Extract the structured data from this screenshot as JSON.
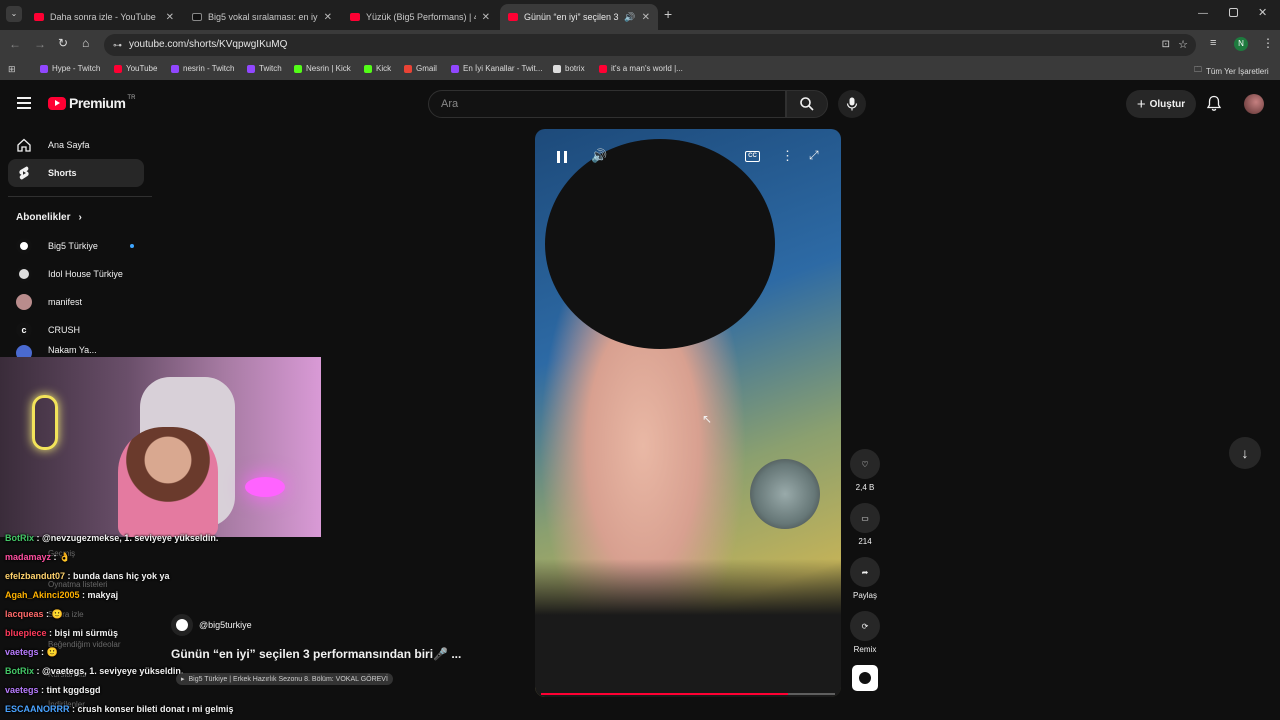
{
  "browser": {
    "tabs": [
      {
        "title": "Daha sonra izle - YouTube",
        "icon": "youtube-icon"
      },
      {
        "title": "Big5 vokal sıralaması: en iyi 22 -",
        "icon": "tiktok-icon"
      },
      {
        "title": "Yüzük (Big5 Performans) | 4. Gr",
        "icon": "youtube-icon"
      },
      {
        "title": "Günün “en iyi” seçilen 3 per",
        "icon": "youtube-icon"
      }
    ],
    "new_tab": "+",
    "url": "youtube.com/shorts/KVqpwgIKuMQ",
    "profile_initial": "N",
    "bookmarks": [
      {
        "label": "Hype - Twitch",
        "color": "#9147ff"
      },
      {
        "label": "YouTube",
        "color": "#ff0033"
      },
      {
        "label": "nesrin - Twitch",
        "color": "#9147ff"
      },
      {
        "label": "Twitch",
        "color": "#9147ff"
      },
      {
        "label": "Nesrin | Kick",
        "color": "#53fc18"
      },
      {
        "label": "Kick",
        "color": "#53fc18"
      },
      {
        "label": "Gmail",
        "color": "#ea4335"
      },
      {
        "label": "En İyi Kanallar - Twit...",
        "color": "#9147ff"
      },
      {
        "label": "botrix",
        "color": "#dddddd"
      },
      {
        "label": "it's a man's world |...",
        "color": "#ff0033"
      }
    ],
    "all_bookmarks": "Tüm Yer İşaretleri"
  },
  "youtube": {
    "logo_text": "Premium",
    "logo_region": "TR",
    "search_placeholder": "Ara",
    "create_label": "Oluştur",
    "sidebar": {
      "items": [
        {
          "label": "Ana Sayfa",
          "icon": "home-icon"
        },
        {
          "label": "Shorts",
          "icon": "shorts-icon"
        }
      ],
      "subs_title": "Abonelikler",
      "subs": [
        {
          "label": "Big5 Türkiye",
          "color": "#ffffff"
        },
        {
          "label": "Idol House Türkiye",
          "color": "#dddddd"
        },
        {
          "label": "manifest",
          "color": "#c9a0a0"
        },
        {
          "label": "CRUSH",
          "color": "#222222"
        },
        {
          "label": "Nakam Ya...",
          "color": "#4a6ad0"
        }
      ]
    },
    "short": {
      "channel": "@big5turkiye",
      "title": "Günün “en iyi” seçilen 3 performansından biri🎤 ...",
      "subtitle": "Big5 Türkiye | Erkek Hazırlık Sezonu 8. Bölüm: VOKAL GÖREVİ",
      "likes": "2,4 B",
      "comments": "214",
      "share": "Paylaş",
      "remix": "Remix",
      "progress_fraction": 0.84
    }
  },
  "overlay_sidebar_text": [
    "Geçmiş",
    "Oynatma listeleri",
    "Sonra izle",
    "Beğendiğim videolar",
    "Kurslarınız",
    "İndirilenler"
  ],
  "chat": [
    {
      "user": "BotRix",
      "sep": " : ",
      "msg": "@nevzugezmekse, 1. seviyeye yükseldin.",
      "color": "#44c767"
    },
    {
      "user": "madamayz",
      "sep": " : ",
      "msg": "👌",
      "color": "#ff4fa0"
    },
    {
      "user": "efelzbandut07",
      "sep": " : ",
      "msg": "bunda dans hiç yok ya",
      "color": "#ffd36e"
    },
    {
      "user": "Agah_Akinci2005",
      "sep": " : ",
      "msg": "makyaj",
      "color": "#ffb200"
    },
    {
      "user": "lacqueas",
      "sep": " : ",
      "msg": "🙂",
      "color": "#ff6a6a"
    },
    {
      "user": "bluepiece",
      "sep": " : ",
      "msg": "bişi mi sürmüş",
      "color": "#ff3b5c"
    },
    {
      "user": "vaetegs",
      "sep": " : ",
      "msg": "🙂",
      "color": "#b87cff"
    },
    {
      "user": "BotRix",
      "sep": " : ",
      "msg": "@vaetegs, 1. seviyeye yükseldin.",
      "color": "#44c767"
    },
    {
      "user": "vaetegs",
      "sep": " : ",
      "msg": "tint kggdsgd",
      "color": "#b87cff"
    },
    {
      "user": "ESCAANORRR",
      "sep": " : ",
      "msg": "crush konser bileti donat ı mi gelmiş",
      "color": "#4aa3ff"
    }
  ]
}
